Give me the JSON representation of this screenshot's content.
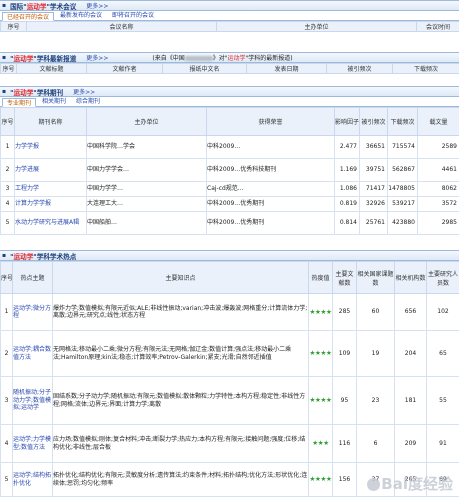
{
  "conf": {
    "title_prefix": "国际",
    "keyword": "运动学",
    "title_suffix": "学术会议",
    "more": "更多>>",
    "tabs": [
      "已经召开的会议",
      "最新发布的会议",
      "即将召开的会议"
    ],
    "cols": [
      "序号",
      "会议名称",
      "主办单位",
      "会议时间"
    ]
  },
  "news": {
    "keyword": "运动学",
    "title_suffix": "学科最新报道",
    "more": "更多>>",
    "source_prefix": "(来自《中国",
    "source_mid": "》对\"",
    "source_suffix": "\"学科的最新报道)",
    "cols": [
      "序号",
      "文献标题",
      "文献作者",
      "报纸中文名",
      "发表日期",
      "被引频次",
      "下载频次"
    ]
  },
  "journals": {
    "keyword": "运动学",
    "title_suffix": "学科期刊",
    "more": "更多>>",
    "tabs": [
      "专业期刊",
      "相关期刊",
      "综合期刊"
    ],
    "cols": [
      "序号",
      "期刊名称",
      "主办单位",
      "获得荣誉",
      "影响因子",
      "被引频次",
      "下载频次",
      "载文量"
    ],
    "rows": [
      {
        "n": "1",
        "name": "力学学报",
        "org": "中国科学院…学会",
        "honor": "中科2009…",
        "if": "2.477",
        "cite": "36651",
        "dl": "715574",
        "count": "2589"
      },
      {
        "n": "2",
        "name": "力学进展",
        "org": "中国力学学会…",
        "honor": "中科2009…优秀科技期刊",
        "if": "1.169",
        "cite": "39751",
        "dl": "562867",
        "count": "4461"
      },
      {
        "n": "3",
        "name": "工程力学",
        "org": "中国力学学…",
        "honor": "Caj-cd规范…",
        "if": "1.086",
        "cite": "71417",
        "dl": "1478805",
        "count": "8062"
      },
      {
        "n": "4",
        "name": "计算力学学报",
        "org": "大连理工大…",
        "honor": "中科2009…优秀期刊",
        "if": "0.819",
        "cite": "32926",
        "dl": "539217",
        "count": "3572"
      },
      {
        "n": "5",
        "name": "水动力学研究与进展A辑",
        "org": "中国船舶…",
        "honor": "中科2009…优秀期刊",
        "if": "0.814",
        "cite": "25761",
        "dl": "423880",
        "count": "2985"
      }
    ]
  },
  "hot": {
    "keyword": "运动学",
    "title_suffix": "学科学术热点",
    "cols": [
      "序号",
      "热点主题",
      "主要知识点",
      "热度值",
      "主要文献数",
      "相关国家课题数",
      "相关机构数",
      "主要研究人员数"
    ],
    "rows": [
      {
        "n": "1",
        "topic": "运动学;微分方程",
        "points": "爆炸力学;数值模拟;有限元近似;ALE;非线性振动;varian;冲击波;爆轰波;网格重分;计算流体力学;离散;边界元;研究点;线性;状态方程",
        "stars": "★★★★",
        "docs": "285",
        "proj": "60",
        "orgs": "656",
        "people": "102"
      },
      {
        "n": "2",
        "topic": "运动学;耦合数值方法",
        "points": "无网格法;移动最小二乘;微分方程;有限元法;无网格;伽辽金;数值计算;强点法;移动最小二乘法;Hamilton原理;kin法;稳态;计算效率;Petrov-Galerkin;紧支;光滑;自然邻近插值",
        "stars": "★★★★",
        "docs": "109",
        "proj": "19",
        "orgs": "204",
        "people": "65"
      },
      {
        "n": "3",
        "topic": "随机振动;分子动力学;数值模拟;运动学",
        "points": "固结系数;分子动力学;随机振动;有限元;数值模拟;散体颗粒;力学特性;本构方程;稳定性;非线性方程;网格;流体;边界元;界面;计算力学;离散",
        "stars": "★★★★",
        "docs": "95",
        "proj": "23",
        "orgs": "181",
        "people": "55"
      },
      {
        "n": "4",
        "topic": "运动学;力学模型;数值方法",
        "points": "应力场;数值模拟;刚体;复合材料;冲击;断裂力学;热应力;本构方程;有限元;接触问题;强度;位移;结构优化;非线性;层合板",
        "stars": "★★★",
        "docs": "116",
        "proj": "6",
        "orgs": "209",
        "people": "91"
      },
      {
        "n": "5",
        "topic": "运动学;结构拓扑优化",
        "points": "拓扑优化;结构优化;有限元;灵敏度分析;遗传算法;约束条件;材料;拓扑结构;优化方法;形状优化;连续体;惩罚;均匀化;频率",
        "stars": "★★★★",
        "docs": "156",
        "proj": "37",
        "orgs": "265",
        "people": "69"
      }
    ]
  },
  "watermark": "Bai度经验"
}
